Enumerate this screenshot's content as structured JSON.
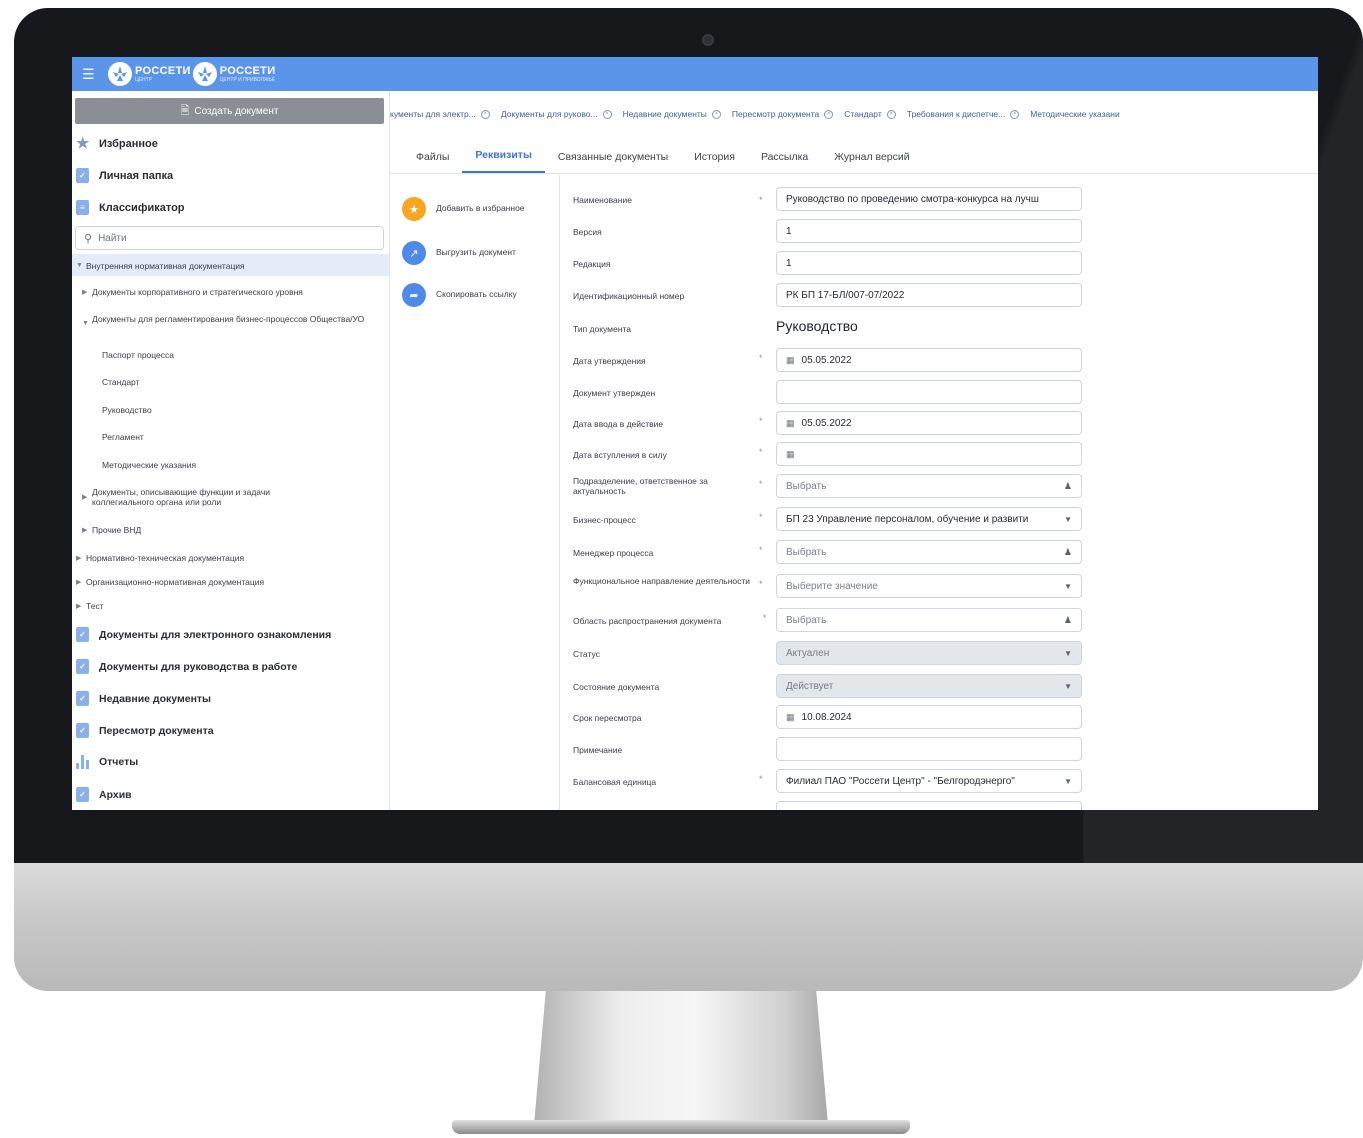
{
  "header": {
    "logo1_big": "РОССЕТИ",
    "logo1_small": "ЦЕНТР",
    "logo2_big": "РОССЕТИ",
    "logo2_small": "ЦЕНТР И ПРИВОЛЖЬЕ",
    "accent_color": "#5b95ea"
  },
  "sidebar": {
    "create_button": "Создать документ",
    "favorites": "Избранное",
    "personal_folder": "Личная папка",
    "classifier": "Классификатор",
    "search_placeholder": "Найти",
    "tree": {
      "internal_docs": "Внутренняя нормативная документация",
      "corporate_level": "Документы корпоративного и стратегического уровня",
      "regulating_docs": "Документы для регламентирования бизнес-процессов Общества/УО",
      "process_passport": "Паспорт процесса",
      "standard": "Стандарт",
      "guide": "Руководство",
      "regulation": "Регламент",
      "methodical": "Методические указания",
      "functions_docs": "Документы, описывающие функции и задачи коллегиального органа или роли",
      "other_vnd": "Прочие ВНД",
      "normative_technical": "Нормативно-техническая документация",
      "organizational_normative": "Организационно-нормативная документация",
      "test": "Тест"
    },
    "electronic_review": "Документы для электронного ознакомления",
    "work_guide_docs": "Документы для руководства в работе",
    "recent_docs": "Недавние документы",
    "doc_review": "Пересмотр документа",
    "reports": "Отчеты",
    "archive": "Архив"
  },
  "open_tabs": [
    "кументы для электр...",
    "Документы для руково...",
    "Недавние документы",
    "Пересмотр документа",
    "Стандарт",
    "Требования к диспетче...",
    "Методические указани"
  ],
  "content_tabs": [
    "Файлы",
    "Реквизиты",
    "Связанные документы",
    "История",
    "Рассылка",
    "Журнал версий"
  ],
  "actions": {
    "add_favorite": "Добавить в избранное",
    "export_doc": "Выгрузить документ",
    "copy_link": "Скопировать ссылку"
  },
  "form": {
    "name_label": "Наименование",
    "name_value": "Руководство по проведению смотра-конкурса на лучш",
    "version_label": "Версия",
    "version_value": "1",
    "edition_label": "Редакция",
    "edition_value": "1",
    "id_label": "Идентификационный номер",
    "id_value": "РК БП 17-БЛ/007-07/2022",
    "type_label": "Тип документа",
    "type_value": "Руководство",
    "approval_date_label": "Дата утверждения",
    "approval_date_value": "05.05.2022",
    "approved_by_label": "Документ утвержден",
    "approved_by_value": "",
    "commission_date_label": "Дата ввода в действие",
    "commission_date_value": "05.05.2022",
    "effective_date_label": "Дата вступления в силу",
    "effective_date_value": "",
    "dept_label": "Подразделение, ответственное за актуальность",
    "dept_value": "Выбрать",
    "business_process_label": "Бизнес-процесс",
    "business_process_value": "БП 23 Управление персоналом, обучение и развити",
    "manager_label": "Менеджер процесса",
    "manager_value": "Выбрать",
    "func_direction_label": "Функциональное направление деятельности",
    "func_direction_value": "Выберите значение",
    "scope_label": "Область распространения документа",
    "scope_value": "Выбрать",
    "status_label": "Статус",
    "status_value": "Актуален",
    "state_label": "Состояние документа",
    "state_value": "Действует",
    "review_term_label": "Срок пересмотра",
    "review_term_value": "10.08.2024",
    "note_label": "Примечание",
    "note_value": "",
    "balance_unit_label": "Балансовая единица",
    "balance_unit_value": "Филиал ПАО \"Россети Центр\" - \"Белгородэнерго\""
  },
  "colors": {
    "primary": "#3e74d4",
    "favorite_orange": "#f5a623",
    "action_blue": "#4f8be6"
  }
}
